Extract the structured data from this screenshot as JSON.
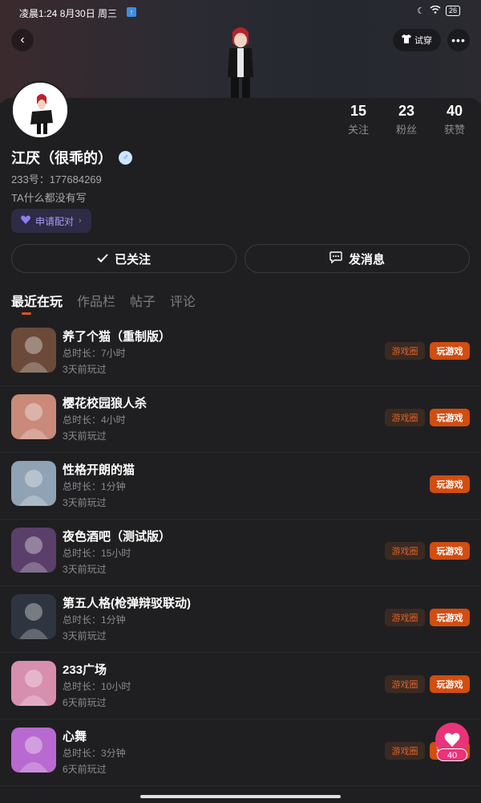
{
  "status_bar": {
    "time": "凌晨1:24  8月30日 周三",
    "battery": "26"
  },
  "header": {
    "tryon_label": "试穿"
  },
  "profile": {
    "name": "江厌（很乖的）",
    "gender_symbol": "♂",
    "uid": "233号：177684269",
    "bio": "TA什么都没有写",
    "pair_label": "申请配对",
    "stats": [
      {
        "num": "15",
        "label": "关注"
      },
      {
        "num": "23",
        "label": "粉丝"
      },
      {
        "num": "40",
        "label": "获赞"
      }
    ]
  },
  "actions": {
    "follow_label": "已关注",
    "message_label": "发消息"
  },
  "tabs": [
    "最近在玩",
    "作品栏",
    "帖子",
    "评论"
  ],
  "games": [
    {
      "title": "养了个猫（重制版）",
      "duration": "总时长：7小时",
      "last": "3天前玩过",
      "has_circle": true,
      "icon_color": "#6b4a3a"
    },
    {
      "title": "樱花校园狼人杀",
      "duration": "总时长：4小时",
      "last": "3天前玩过",
      "has_circle": true,
      "icon_color": "#c98a7a"
    },
    {
      "title": "性格开朗的猫",
      "duration": "总时长：1分钟",
      "last": "3天前玩过",
      "has_circle": false,
      "icon_color": "#8fa3b5"
    },
    {
      "title": "夜色酒吧（测试版）",
      "duration": "总时长：15小时",
      "last": "3天前玩过",
      "has_circle": true,
      "icon_color": "#5a3f6a"
    },
    {
      "title": "第五人格(枪弹辩驳联动)",
      "duration": "总时长：1分钟",
      "last": "3天前玩过",
      "has_circle": true,
      "icon_color": "#2f3540"
    },
    {
      "title": "233广场",
      "duration": "总时长：10小时",
      "last": "6天前玩过",
      "has_circle": true,
      "icon_color": "#d78fb0"
    },
    {
      "title": "心舞",
      "duration": "总时长：3分钟",
      "last": "6天前玩过",
      "has_circle": true,
      "icon_color": "#b86ad0"
    }
  ],
  "game_buttons": {
    "circle_label": "游戏圈",
    "play_label": "玩游戏"
  },
  "like_fab": {
    "count": "40"
  },
  "colors": {
    "accent": "#d24d10",
    "like": "#e9337a",
    "pair": "#a99cf5"
  }
}
